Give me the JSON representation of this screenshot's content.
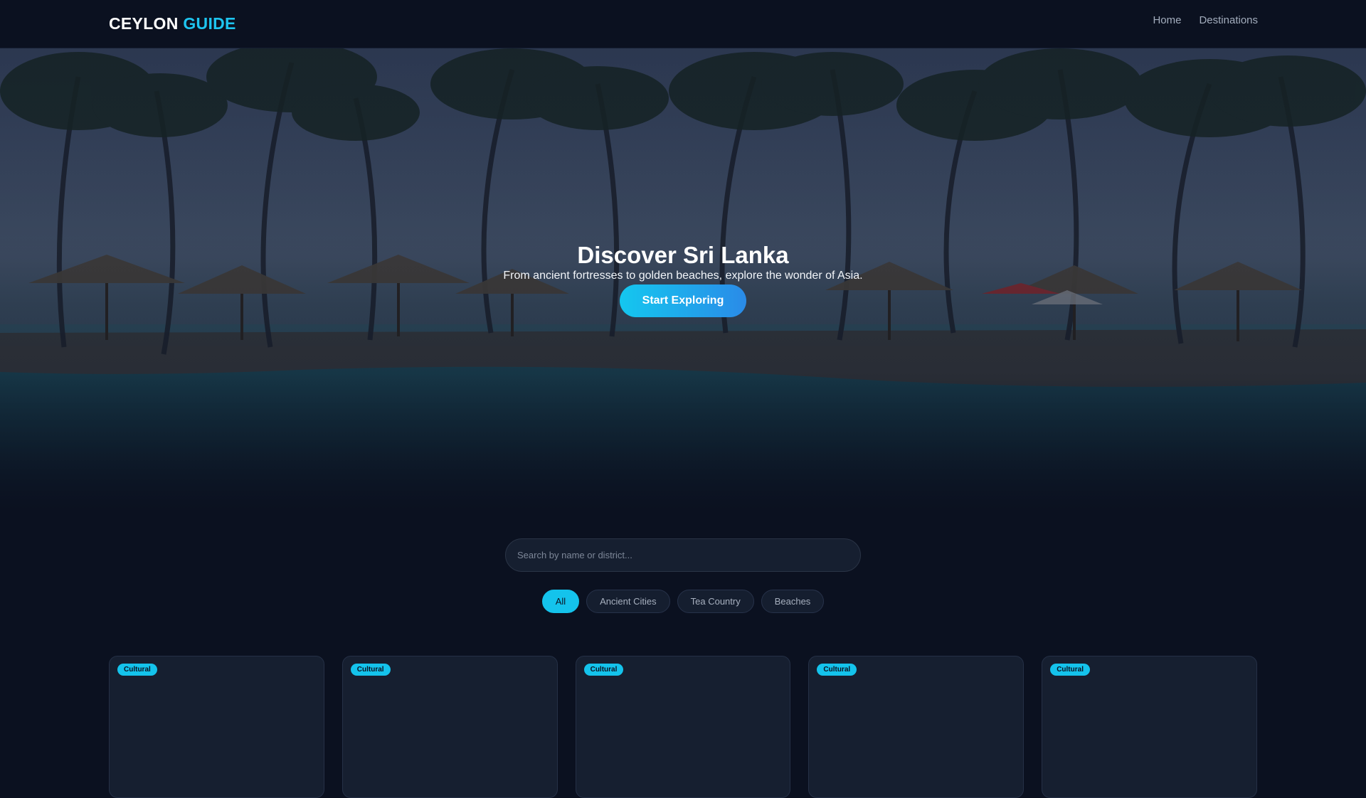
{
  "header": {
    "logo_primary": "CEYLON",
    "logo_accent": "GUIDE",
    "nav": [
      {
        "label": "Home"
      },
      {
        "label": "Destinations"
      }
    ]
  },
  "hero": {
    "title": "Discover Sri Lanka",
    "subtitle": "From ancient fortresses to golden beaches, explore the wonder of Asia.",
    "cta_label": "Start Exploring",
    "background": "beach resort with palm trees, thatched umbrellas and pool"
  },
  "search": {
    "placeholder": "Search by name or district...",
    "value": ""
  },
  "filters": {
    "selected": "All",
    "options": [
      {
        "label": "All"
      },
      {
        "label": "Ancient Cities"
      },
      {
        "label": "Tea Country"
      },
      {
        "label": "Beaches"
      }
    ]
  },
  "cards": [
    {
      "badge": "Cultural"
    },
    {
      "badge": "Cultural"
    },
    {
      "badge": "Cultural"
    },
    {
      "badge": "Cultural"
    },
    {
      "badge": "Cultural"
    }
  ],
  "colors": {
    "background": "#0b1120",
    "accent": "#14c3ec",
    "card": "#161f30",
    "nav_text": "#a3adbd"
  }
}
